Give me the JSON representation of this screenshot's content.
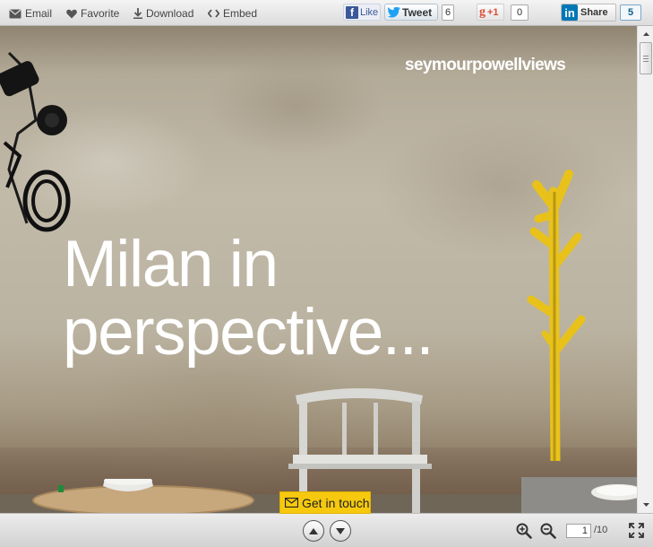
{
  "toolbar": {
    "email": "Email",
    "favorite": "Favorite",
    "download": "Download",
    "embed": "Embed"
  },
  "social": {
    "facebook_label": "Like",
    "twitter_label": "Tweet",
    "twitter_count": "6",
    "gplus_label": "+1",
    "gplus_count": "0",
    "linkedin_label": "Share",
    "linkedin_count": "5"
  },
  "slide": {
    "brand": "seymourpowellviews",
    "headline_line1": "Milan in",
    "headline_line2": "perspective..."
  },
  "cta": {
    "label": "Get in touch"
  },
  "pager": {
    "current_page": "1",
    "total_pages": "/10"
  },
  "icons": {
    "email": "envelope-icon",
    "favorite": "heart-icon",
    "download": "download-arrow-icon",
    "embed": "code-brackets-icon",
    "prev": "chevron-up-icon",
    "next": "chevron-down-icon",
    "zoom_in": "zoom-in-icon",
    "zoom_out": "zoom-out-icon",
    "fullscreen": "fullscreen-icon"
  },
  "colors": {
    "cta_background": "#f6c90f",
    "facebook": "#3b5998",
    "twitter": "#1da1f2",
    "gplus": "#dd4b39",
    "linkedin": "#0077b5",
    "hanger_yellow": "#e8c21a"
  }
}
